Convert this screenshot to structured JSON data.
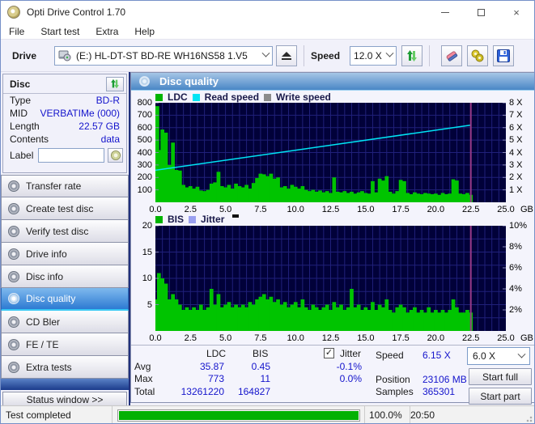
{
  "window": {
    "title": "Opti Drive Control 1.70"
  },
  "menu": {
    "items": [
      {
        "label": "File"
      },
      {
        "label": "Start test"
      },
      {
        "label": "Extra"
      },
      {
        "label": "Help"
      }
    ]
  },
  "toolbar": {
    "drive_label": "Drive",
    "drive_value": "(E:)  HL-DT-ST BD-RE  WH16NS58 1.V5",
    "speed_label": "Speed",
    "speed_value": "12.0 X"
  },
  "disc_panel": {
    "title": "Disc",
    "rows": [
      {
        "label": "Type",
        "value": "BD-R"
      },
      {
        "label": "MID",
        "value": "VERBATIMe (000)"
      },
      {
        "label": "Length",
        "value": "22.57 GB"
      },
      {
        "label": "Contents",
        "value": "data"
      }
    ],
    "label_row": {
      "label": "Label",
      "value": ""
    }
  },
  "nav": {
    "items": [
      {
        "label": "Transfer rate"
      },
      {
        "label": "Create test disc"
      },
      {
        "label": "Verify test disc"
      },
      {
        "label": "Drive info"
      },
      {
        "label": "Disc info"
      },
      {
        "label": "Disc quality",
        "selected": true
      },
      {
        "label": "CD Bler"
      },
      {
        "label": "FE / TE"
      },
      {
        "label": "Extra tests"
      }
    ],
    "status_window_label": "Status window >>"
  },
  "main": {
    "header": "Disc quality"
  },
  "stats": {
    "col_headers": {
      "ldc": "LDC",
      "bis": "BIS",
      "jitter": "Jitter"
    },
    "jitter_checked": true,
    "rows": [
      {
        "label": "Avg",
        "ldc": "35.87",
        "bis": "0.45",
        "jitter": "-0.1%"
      },
      {
        "label": "Max",
        "ldc": "773",
        "bis": "11",
        "jitter": "0.0%"
      },
      {
        "label": "Total",
        "ldc": "13261220",
        "bis": "164827",
        "jitter": ""
      }
    ],
    "right": [
      {
        "label": "Speed",
        "value": "6.15 X"
      },
      {
        "label": "Position",
        "value": "23106 MB"
      },
      {
        "label": "Samples",
        "value": "365301"
      }
    ],
    "speed_select_value": "6.0 X",
    "start_full_label": "Start full",
    "start_part_label": "Start part"
  },
  "statusbar": {
    "text": "Test completed",
    "progress_percent": 100,
    "percent_label": "100.0%",
    "time": "20:50"
  },
  "colors": {
    "accent_blue": "#2d7ad2",
    "value_text": "#1414cc",
    "plot_background": "#010139",
    "grid": "#20207a",
    "ldc_green": "#00c400",
    "read_speed_cyan": "#00e4f4",
    "write_speed_gray": "#8c8c8c",
    "jitter_periwinkle": "#9aa0f0",
    "position_marker": "#973a88",
    "progress_green": "#04b104"
  },
  "chart_data": [
    {
      "type": "area",
      "title": "LDC / Read speed vs position",
      "legend": [
        {
          "label": "LDC",
          "color": "#00b400"
        },
        {
          "label": "Read speed",
          "color": "#00e4f4"
        },
        {
          "label": "Write speed",
          "color": "#8c8c8c"
        }
      ],
      "xlim": [
        0,
        25
      ],
      "ylim": [
        0,
        800
      ],
      "grid_x_step": 0.5,
      "grid_y_step": 100,
      "plot_bg": "#010139",
      "grid_color": "#20207a",
      "left_ticks": [
        100,
        200,
        300,
        400,
        500,
        600,
        700,
        800
      ],
      "right_ticks": [
        {
          "v": 100,
          "t": "1 X"
        },
        {
          "v": 200,
          "t": "2 X"
        },
        {
          "v": 300,
          "t": "3 X"
        },
        {
          "v": 400,
          "t": "4 X"
        },
        {
          "v": 500,
          "t": "5 X"
        },
        {
          "v": 600,
          "t": "6 X"
        },
        {
          "v": 700,
          "t": "7 X"
        },
        {
          "v": 800,
          "t": "8 X"
        }
      ],
      "x_ticks": [
        {
          "v": 0,
          "t": "0.0"
        },
        {
          "v": 2.5,
          "t": "2.5"
        },
        {
          "v": 5,
          "t": "5.0"
        },
        {
          "v": 7.5,
          "t": "7.5"
        },
        {
          "v": 10,
          "t": "10.0"
        },
        {
          "v": 12.5,
          "t": "12.5"
        },
        {
          "v": 15,
          "t": "15.0"
        },
        {
          "v": 17.5,
          "t": "17.5"
        },
        {
          "v": 20,
          "t": "20.0"
        },
        {
          "v": 22.5,
          "t": "22.5"
        },
        {
          "v": 25,
          "t": "25.0"
        }
      ],
      "x_unit": "GB",
      "marker_x": 22.5,
      "marker_color": "#973a88",
      "series": [
        {
          "name": "LDC",
          "type": "bars",
          "color": "#00c400",
          "x_start": 0,
          "x_step": 0.25,
          "values": [
            773,
            420,
            585,
            560,
            300,
            480,
            260,
            255,
            140,
            120,
            130,
            110,
            125,
            95,
            90,
            100,
            150,
            160,
            245,
            130,
            120,
            140,
            110,
            150,
            130,
            120,
            140,
            110,
            155,
            195,
            230,
            225,
            210,
            230,
            190,
            200,
            120,
            130,
            110,
            140,
            125,
            110,
            130,
            100,
            90,
            100,
            85,
            95,
            80,
            90,
            75,
            200,
            85,
            80,
            90,
            75,
            85,
            70,
            80,
            90,
            75,
            70,
            170,
            80,
            190,
            175,
            210,
            85,
            70,
            90,
            180,
            170,
            75,
            65,
            80,
            70,
            65,
            75,
            70,
            65,
            70,
            60,
            75,
            65,
            70,
            185,
            175,
            70,
            65,
            75,
            60
          ]
        },
        {
          "name": "Read speed",
          "type": "line",
          "color": "#00e4f4",
          "points": [
            [
              0,
              258
            ],
            [
              22.5,
              620
            ]
          ]
        }
      ]
    },
    {
      "type": "area",
      "title": "BIS / Jitter vs position",
      "legend": [
        {
          "label": "BIS",
          "color": "#00b400"
        },
        {
          "label": "Jitter",
          "color": "#9aa0f0"
        }
      ],
      "xlim": [
        0,
        25
      ],
      "ylim": [
        0,
        20
      ],
      "grid_x_step": 0.5,
      "grid_y_step": 2.5,
      "plot_bg": "#010139",
      "grid_color": "#20207a",
      "left_ticks": [
        5,
        10,
        15,
        20
      ],
      "right_ticks": [
        {
          "v": 4,
          "t": "2%"
        },
        {
          "v": 8,
          "t": "4%"
        },
        {
          "v": 12,
          "t": "6%"
        },
        {
          "v": 16,
          "t": "8%"
        },
        {
          "v": 20,
          "t": "10%"
        }
      ],
      "x_ticks": [
        {
          "v": 0,
          "t": "0.0"
        },
        {
          "v": 2.5,
          "t": "2.5"
        },
        {
          "v": 5,
          "t": "5.0"
        },
        {
          "v": 7.5,
          "t": "7.5"
        },
        {
          "v": 10,
          "t": "10.0"
        },
        {
          "v": 12.5,
          "t": "12.5"
        },
        {
          "v": 15,
          "t": "15.0"
        },
        {
          "v": 17.5,
          "t": "17.5"
        },
        {
          "v": 20,
          "t": "20.0"
        },
        {
          "v": 22.5,
          "t": "22.5"
        },
        {
          "v": 25,
          "t": "25.0"
        }
      ],
      "x_unit": "GB",
      "marker_x": 22.5,
      "marker_color": "#973a88",
      "series": [
        {
          "name": "BIS",
          "type": "bars",
          "color": "#00c400",
          "x_start": 0,
          "x_step": 0.25,
          "values": [
            6,
            11,
            10,
            9,
            6,
            7,
            6,
            5,
            4,
            4.5,
            4,
            4.5,
            4,
            5,
            4,
            4.5,
            8,
            5,
            7,
            4.5,
            5,
            5.5,
            4.5,
            5,
            4.5,
            5,
            4.5,
            5.5,
            5,
            6,
            6.5,
            7,
            6,
            6.5,
            5.5,
            6,
            5,
            5.5,
            4.5,
            5,
            5.5,
            4.5,
            6,
            4.5,
            4,
            5,
            4.5,
            4,
            4.5,
            5,
            4,
            5.5,
            4.5,
            5,
            4,
            4.5,
            8,
            4.5,
            5,
            4,
            4.5,
            4,
            5.5,
            4,
            5,
            4.5,
            6,
            4,
            3.5,
            4.5,
            5,
            4.5,
            3.5,
            4,
            4.5,
            3.5,
            4,
            3.5,
            4.5,
            3.5,
            4,
            3.5,
            4,
            3.5,
            4,
            6,
            4.5,
            3.5,
            3.5,
            4,
            3.5
          ]
        }
      ]
    }
  ]
}
